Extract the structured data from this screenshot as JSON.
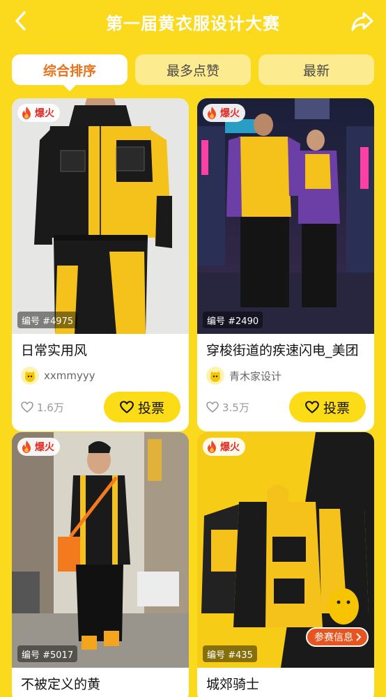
{
  "header": {
    "title": "第一届黄衣服设计大赛"
  },
  "tabs": [
    {
      "label": "综合排序",
      "active": true
    },
    {
      "label": "最多点赞",
      "active": false
    },
    {
      "label": "最新",
      "active": false
    }
  ],
  "badge_hot": "爆火",
  "vote_label": "投票",
  "cards": [
    {
      "serial": "编号 #4975",
      "name": "日常实用风",
      "author": "xxmmyyy",
      "likes": "1.6万"
    },
    {
      "serial": "编号 #2490",
      "name": "穿梭街道的疾速闪电_美团",
      "author": "青木家设计",
      "likes": "3.5万"
    },
    {
      "serial": "编号 #5017",
      "name": "不被定义的黄",
      "author": "",
      "likes": ""
    },
    {
      "serial": "编号 #435",
      "name": "城郊骑士",
      "author": "",
      "likes": ""
    }
  ],
  "info_button": "参赛信息",
  "colors": {
    "background": "#FBD91C",
    "accent": "#E8731A",
    "vote_button": "#FCDB17",
    "hot_text": "#E0302A"
  },
  "icons": [
    "back-arrow-icon",
    "share-icon",
    "flame-icon",
    "heart-icon"
  ]
}
